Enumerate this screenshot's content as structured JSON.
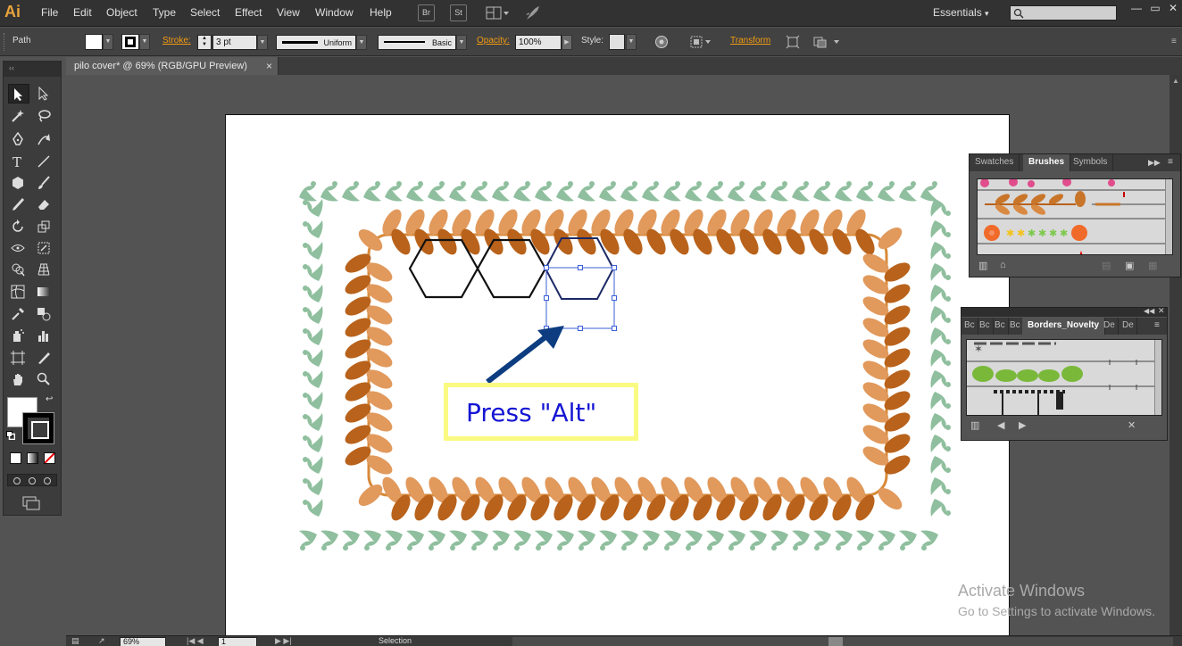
{
  "app": {
    "logo": "Ai"
  },
  "menu": [
    "File",
    "Edit",
    "Object",
    "Type",
    "Select",
    "Effect",
    "View",
    "Window",
    "Help"
  ],
  "menubar_buttons": {
    "bridge": "Br",
    "stock": "St"
  },
  "workspace": "Essentials",
  "window_controls": {
    "minimize": "—",
    "restore": "▭",
    "close": "✕"
  },
  "control_bar": {
    "selection_type": "Path",
    "stroke_label": "Stroke:",
    "stroke_weight": "3 pt",
    "profile": "Uniform",
    "brush": "Basic",
    "opacity_label": "Opacity:",
    "opacity_value": "100%",
    "style_label": "Style:",
    "transform_label": "Transform"
  },
  "document": {
    "tab_title": "pilo cover* @ 69% (RGB/GPU Preview)",
    "close": "×"
  },
  "status_bar": {
    "zoom": "69%",
    "artboard": "1",
    "tool": "Selection"
  },
  "panels": {
    "brushes": {
      "tabs": [
        "Swatches",
        "Brushes",
        "Symbols"
      ],
      "active": "Brushes"
    },
    "borders": {
      "tabs": [
        "Bc",
        "Bc",
        "Bc",
        "Bc",
        "Borders_Novelty",
        "De",
        "De"
      ],
      "active": "Borders_Novelty"
    }
  },
  "annotation": {
    "callout_text": "Press \"Alt\""
  },
  "watermark": {
    "title": "Activate Windows",
    "subtitle": "Go to Settings to activate Windows."
  },
  "colors": {
    "accent": "#f39c12",
    "leaf_dark": "#b8621b",
    "leaf_light": "#e1995c",
    "vine_green": "#8fbf9e",
    "callout_border": "#fafa82",
    "callout_text": "#1515d4",
    "arrow": "#0d3d80",
    "selection_blue": "#3a5fd6"
  }
}
